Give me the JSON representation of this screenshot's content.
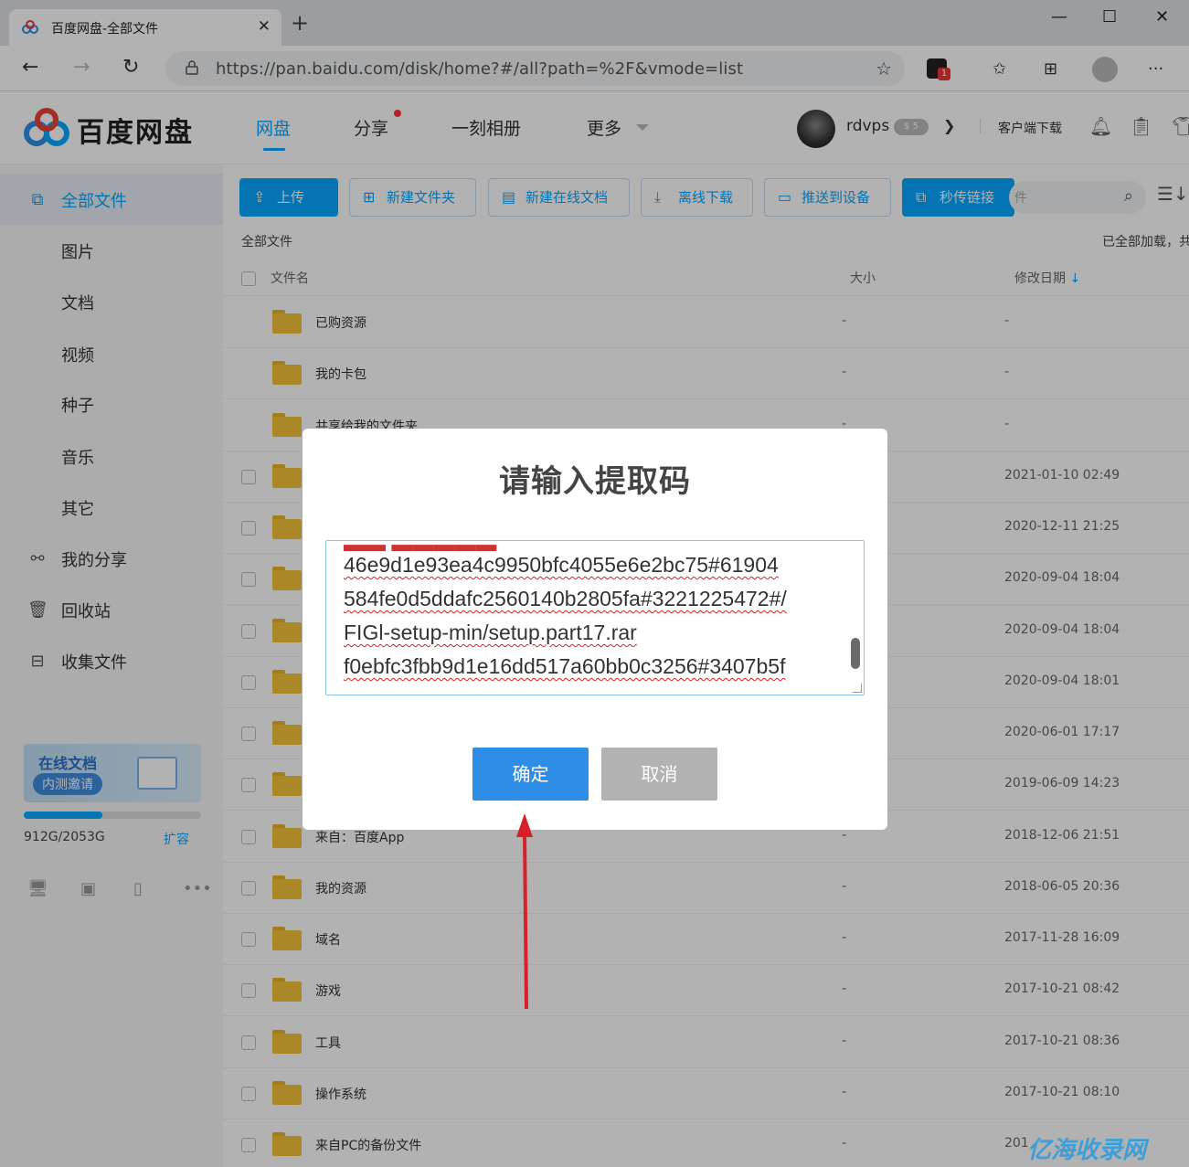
{
  "browser": {
    "tab_title": "百度网盘-全部文件",
    "url": "https://pan.baidu.com/disk/home?#/all?path=%2F&vmode=list",
    "ext_badge": "1"
  },
  "header": {
    "logo_text": "百度网盘",
    "nav": [
      "网盘",
      "分享",
      "一刻相册",
      "更多"
    ],
    "username": "rdvps",
    "vip_badge": "$ 5",
    "client_download": "客户端下载"
  },
  "sidebar": {
    "items": [
      {
        "label": "全部文件",
        "icon": "all-files-icon"
      },
      {
        "label": "图片"
      },
      {
        "label": "文档"
      },
      {
        "label": "视频"
      },
      {
        "label": "种子"
      },
      {
        "label": "音乐"
      },
      {
        "label": "其它"
      },
      {
        "label": "我的分享",
        "icon": "share-icon"
      },
      {
        "label": "回收站",
        "icon": "trash-icon"
      },
      {
        "label": "收集文件",
        "icon": "inbox-icon"
      }
    ],
    "promo_title": "在线文档",
    "promo_sub": "内测邀请",
    "quota_text": "912G/2053G",
    "quota_fraction": 0.444,
    "expand": "扩容"
  },
  "toolbar": {
    "upload": "上传",
    "new_folder": "新建文件夹",
    "new_doc": "新建在线文档",
    "offline": "离线下载",
    "push": "推送到设备",
    "instant_link": "秒传链接",
    "search_placeholder": "件"
  },
  "list": {
    "breadcrumb": "全部文件",
    "loaded": "已全部加载，共",
    "col_name": "文件名",
    "col_size": "大小",
    "col_date": "修改日期",
    "rows": [
      {
        "name": "已购资源",
        "size": "-",
        "date": "-"
      },
      {
        "name": "我的卡包",
        "size": "-",
        "date": "-"
      },
      {
        "name": "共享给我的文件夹",
        "size": "-",
        "date": "-"
      },
      {
        "name": "",
        "size": "",
        "date": "2021-01-10 02:49"
      },
      {
        "name": "",
        "size": "",
        "date": "2020-12-11 21:25"
      },
      {
        "name": "",
        "size": "",
        "date": "2020-09-04 18:04"
      },
      {
        "name": "",
        "size": "",
        "date": "2020-09-04 18:04"
      },
      {
        "name": "",
        "size": "",
        "date": "2020-09-04 18:01"
      },
      {
        "name": "",
        "size": "",
        "date": "2020-06-01 17:17"
      },
      {
        "name": "",
        "size": "",
        "date": "2019-06-09 14:23"
      },
      {
        "name": "来自：百度App",
        "size": "-",
        "date": "2018-12-06 21:51"
      },
      {
        "name": "我的资源",
        "size": "-",
        "date": "2018-06-05 20:36"
      },
      {
        "name": "域名",
        "size": "-",
        "date": "2017-11-28 16:09"
      },
      {
        "name": "游戏",
        "size": "-",
        "date": "2017-10-21 08:42"
      },
      {
        "name": "工具",
        "size": "-",
        "date": "2017-10-21 08:36"
      },
      {
        "name": "操作系统",
        "size": "-",
        "date": "2017-10-21 08:10"
      },
      {
        "name": "来自PC的备份文件",
        "size": "-",
        "date": "201"
      }
    ]
  },
  "dialog": {
    "title": "请输入提取码",
    "lines": [
      "46e9d1e93ea4c9950bfc4055e6e2bc75#61904",
      "584fe0d5ddafc2560140b2805fa#3221225472#/",
      "FIGl-setup-min/setup.part17.rar",
      "f0ebfc3fbb9d1e16dd517a60bb0c3256#3407b5f"
    ],
    "confirm": "确定",
    "cancel": "取消"
  },
  "watermark": "亿海收录网",
  "colors": {
    "accent": "#06a7ff",
    "confirm": "#2e8ee6",
    "cancel": "#b3b3b3",
    "folder": "#f5c338"
  }
}
